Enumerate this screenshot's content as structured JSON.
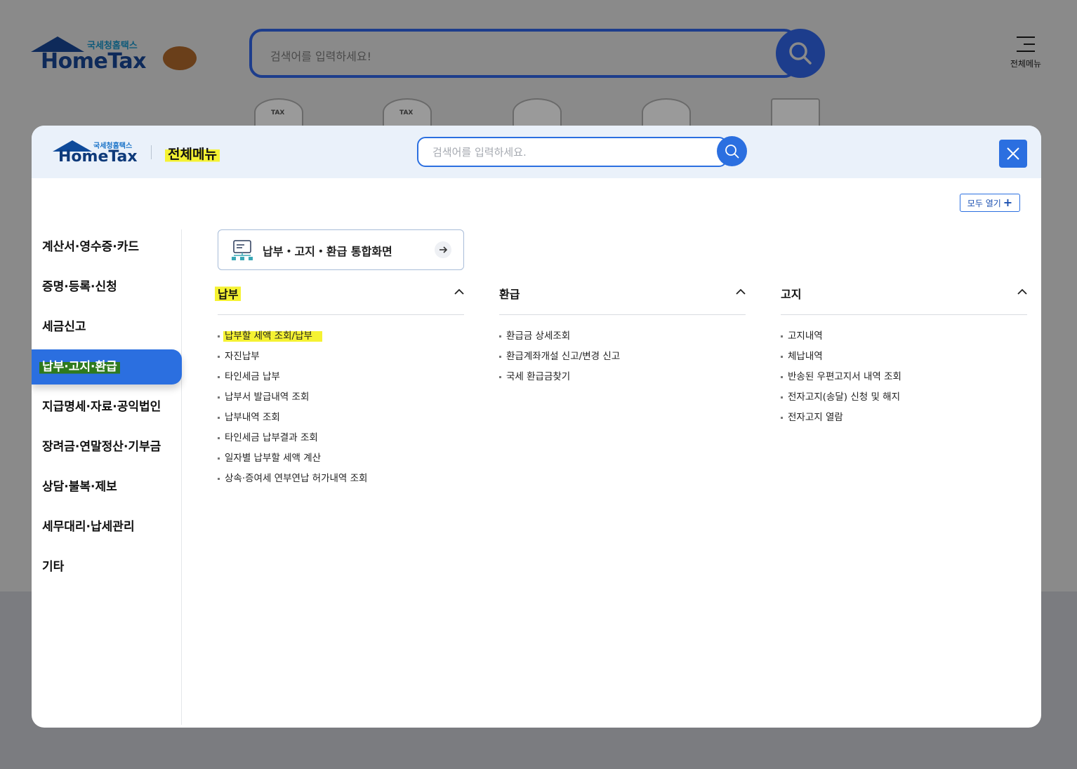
{
  "background": {
    "logo_small": "국세청홈택스",
    "logo_big": "HomeTax",
    "search_placeholder": "검색어를 입력하세요!",
    "menu_label": "전체메뉴",
    "icon_tax": "TAX"
  },
  "modal": {
    "logo_small": "국세청홈택스",
    "logo_big": "HomeTax",
    "title": "전체메뉴",
    "search_placeholder": "검색어를 입력하세요.",
    "expand_all_label": "모두 열기",
    "expand_all_symbol": "+"
  },
  "sidebar": {
    "items": [
      {
        "label": "계산서·영수증·카드"
      },
      {
        "label": "증명·등록·신청"
      },
      {
        "label": "세금신고"
      },
      {
        "label": "납부·고지·환급"
      },
      {
        "label": "지급명세·자료·공익법인"
      },
      {
        "label": "장려금·연말정산·기부금"
      },
      {
        "label": "상담·불복·제보"
      },
      {
        "label": "세무대리·납세관리"
      },
      {
        "label": "기타"
      }
    ],
    "active_index": 3
  },
  "shortcut": {
    "label": "납부・고지・환급 통합화면"
  },
  "columns": [
    {
      "title": "납부",
      "items": [
        "납부할 세액 조회/납부",
        "자진납부",
        "타인세금 납부",
        "납부서 발급내역 조회",
        "납부내역 조회",
        "타인세금 납부결과 조회",
        "일자별 납부할 세액 계산",
        "상속·증여세 연부연납 허가내역 조회"
      ]
    },
    {
      "title": "환급",
      "items": [
        "환급금 상세조회",
        "환급계좌개설 신고/변경 신고",
        "국세 환급금찾기"
      ]
    },
    {
      "title": "고지",
      "items": [
        "고지내역",
        "체납내역",
        "반송된 우편고지서 내역 조회",
        "전자고지(송달) 신청 및 해지",
        "전자고지 열람"
      ]
    }
  ],
  "colors": {
    "accent": "#2b6fe0",
    "highlight": "#f5f232",
    "header_bg": "#eaf1fa"
  }
}
